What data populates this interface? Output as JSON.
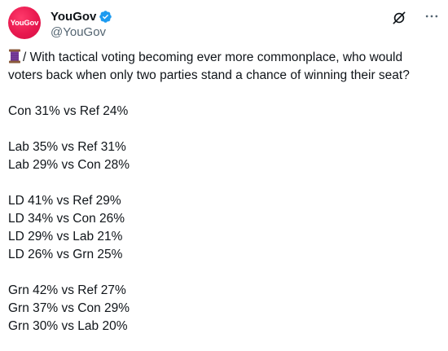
{
  "tweet": {
    "avatar_text": "YouGov",
    "display_name": "YouGov",
    "handle": "@YouGov",
    "intro_suffix": "/ With tactical voting becoming ever more commonplace, who would",
    "intro_line2": "voters back when only two parties stand a chance of winning their seat?",
    "groups": [
      [
        "Con 31% vs Ref 24%"
      ],
      [
        "Lab 35% vs Ref 31%",
        "Lab 29% vs Con 28%"
      ],
      [
        "LD 41% vs Ref 29%",
        "LD 34% vs Con 26%",
        "LD 29% vs Lab 21%",
        "LD 26% vs Grn 25%"
      ],
      [
        "Grn 42% vs Ref 27%",
        "Grn 37% vs Con 29%",
        "Grn 30% vs Lab 20%"
      ]
    ]
  },
  "icons": {
    "verified": "verified-badge-icon",
    "grok": "grok-icon",
    "more": "more-options-icon",
    "thread": "thread-spool-emoji"
  },
  "colors": {
    "brand": "#e8194f",
    "verified": "#1d9bf0",
    "text": "#0f1419",
    "muted": "#536471"
  }
}
